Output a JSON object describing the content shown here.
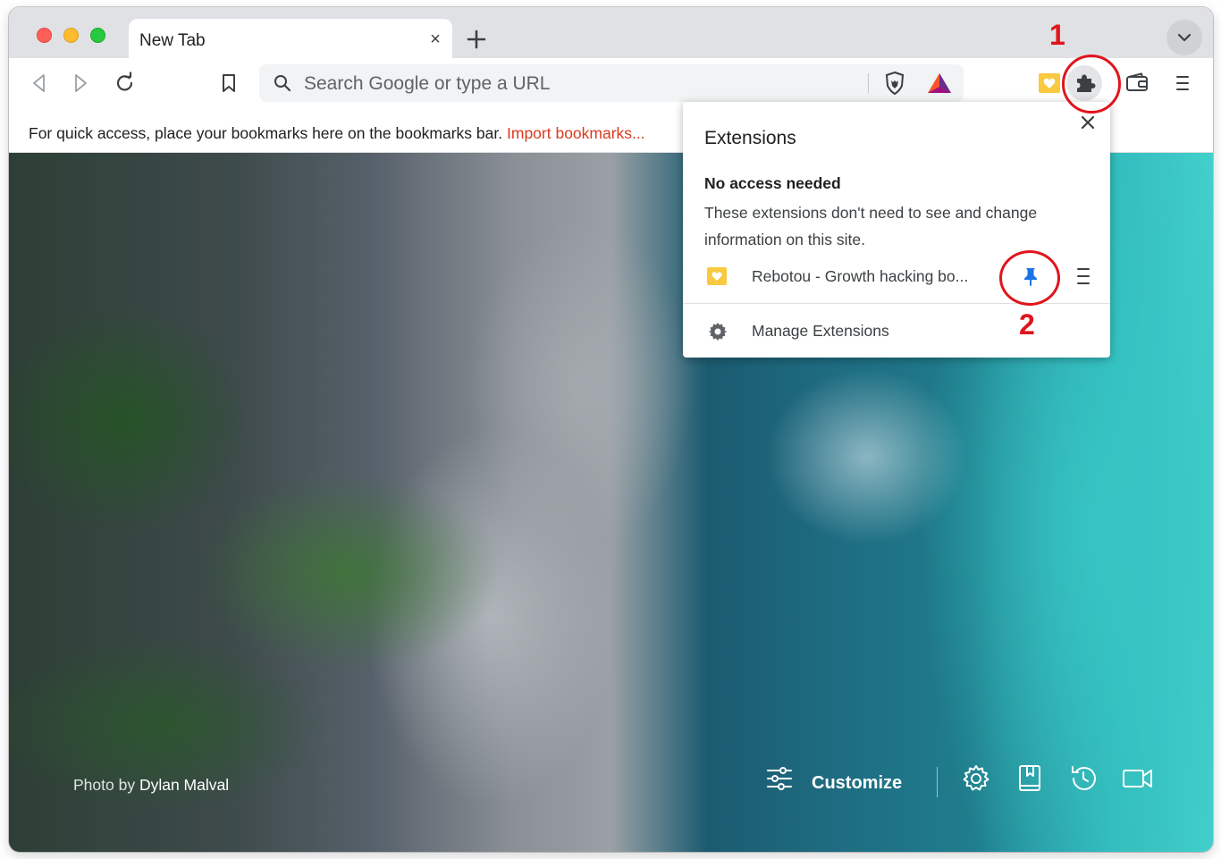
{
  "tab": {
    "title": "New Tab",
    "close_glyph": "×",
    "new_tab_glyph": "+"
  },
  "toolbar": {
    "omnibox_placeholder": "Search Google or type a URL",
    "icons": [
      "back-icon",
      "forward-icon",
      "reload-icon",
      "bookmark-icon",
      "brave-shields-icon",
      "brave-rewards-icon",
      "rebotou-extension-icon",
      "extensions-puzzle-icon",
      "wallet-icon",
      "menu-icon"
    ]
  },
  "bookmarks_bar": {
    "message": "For quick access, place your bookmarks here on the bookmarks bar.",
    "import_link": "Import bookmarks..."
  },
  "extensions_popup": {
    "title": "Extensions",
    "section_heading": "No access needed",
    "section_description": "These extensions don't need to see and change information on this site.",
    "extension_name": "Rebotou - Growth hacking bo...",
    "manage_label": "Manage Extensions"
  },
  "ntp": {
    "photo_credit_prefix": "Photo by",
    "photo_credit_author": "Dylan Malval",
    "customize_label": "Customize"
  },
  "annotations": {
    "step1": "1",
    "step2": "2"
  },
  "colors": {
    "annotation_red": "#e1141c",
    "pin_blue": "#1a73e8",
    "link_red": "#d93a1f",
    "rebotou_yellow": "#f9c93f"
  }
}
